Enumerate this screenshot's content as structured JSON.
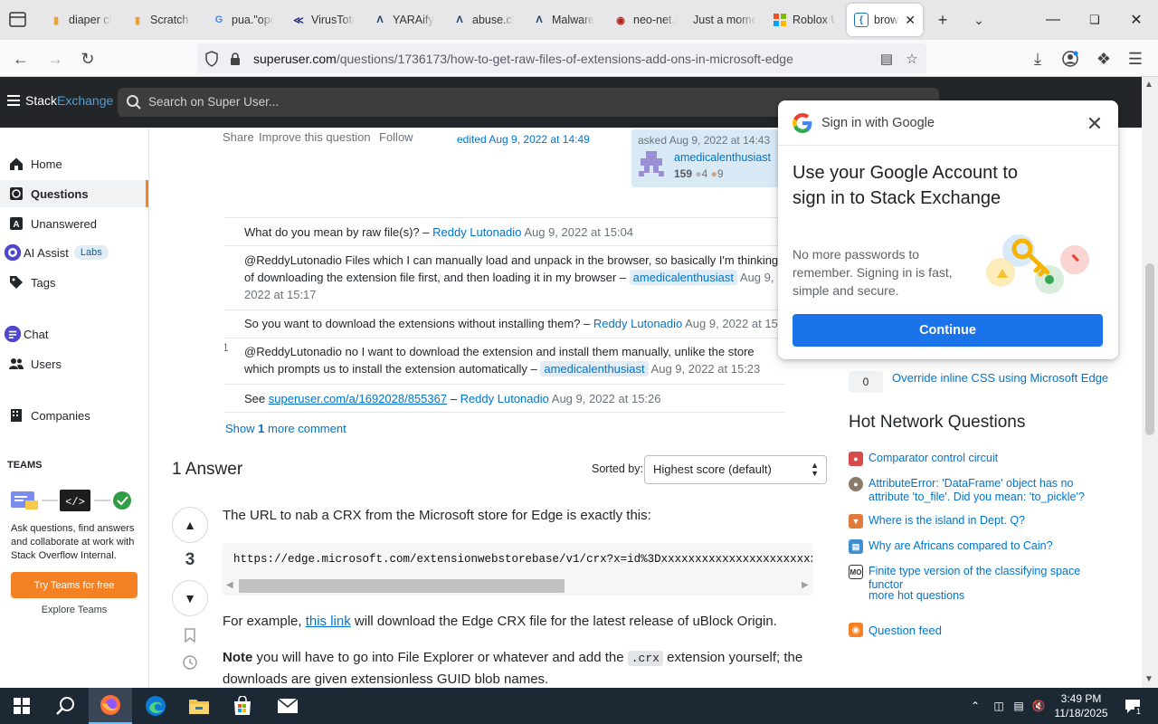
{
  "browser": {
    "tabs": [
      {
        "label": "diaper cl",
        "icon": "page-icon"
      },
      {
        "label": "Scratch -",
        "icon": "page-icon"
      },
      {
        "label": "pua.\"ope",
        "icon": "google-icon"
      },
      {
        "label": "VirusTota",
        "icon": "virustotal-icon"
      },
      {
        "label": "YARAify |",
        "icon": "yaraify-icon"
      },
      {
        "label": "abuse.ch",
        "icon": "abusech-icon"
      },
      {
        "label": "Malware",
        "icon": "abusech-icon"
      },
      {
        "label": "neo-net.i",
        "icon": "neonet-icon"
      },
      {
        "label": "Just a mome",
        "icon": "none"
      },
      {
        "label": "Roblox U",
        "icon": "roblox-icon"
      },
      {
        "label": "brows",
        "icon": "superuser-icon",
        "active": true
      }
    ],
    "url_host": "superuser.com",
    "url_path": "/questions/1736173/how-to-get-raw-files-of-extensions-add-ons-in-microsoft-edge"
  },
  "topbar": {
    "logo_stack": "Stack",
    "logo_exchange": "Exchange",
    "search_placeholder": "Search on Super User..."
  },
  "leftnav": {
    "items": [
      {
        "label": "Home",
        "icon": "home-icon"
      },
      {
        "label": "Questions",
        "icon": "globe-icon",
        "active": true
      },
      {
        "label": "Unanswered",
        "icon": "unanswered-icon"
      },
      {
        "label": "AI Assist",
        "icon": "ai-assist-icon",
        "badge": "Labs"
      },
      {
        "label": "Tags",
        "icon": "tag-icon"
      },
      {
        "label": "Chat",
        "icon": "chat-icon"
      },
      {
        "label": "Users",
        "icon": "users-icon"
      },
      {
        "label": "Companies",
        "icon": "companies-icon"
      }
    ],
    "teams_title": "TEAMS",
    "teams_desc": "Ask questions, find answers and collaborate at work with Stack Overflow Internal.",
    "teams_button": "Try Teams for free",
    "teams_explore": "Explore Teams"
  },
  "question": {
    "share": "Share",
    "improve": "Improve this question",
    "follow": "Follow",
    "edited": "edited Aug 9, 2022 at 14:49",
    "asked": "asked Aug 9, 2022 at 14:43",
    "asker": "amedicalenthusiast",
    "rep": "159",
    "silver": "4",
    "bronze": "9"
  },
  "comments": [
    {
      "score": "",
      "text": "What do you mean by raw file(s)? –",
      "user": "Reddy Lutonadio",
      "date": "Aug 9, 2022 at 15:04"
    },
    {
      "score": "",
      "text": "@ReddyLutonadio Files which I can manually load and unpack in the browser, so basically I'm thinking of downloading the extension file first, and then loading it in my browser –",
      "user": "amedicalenthusiast",
      "date": "Aug 9, 2022 at 15:17"
    },
    {
      "score": "",
      "text": "So you want to download the extensions without installing them? –",
      "user": "Reddy Lutonadio",
      "date": "Aug 9, 2022 at 15:"
    },
    {
      "score": "1",
      "text": "@ReddyLutonadio no I want to download the extension and install them manually, unlike the store which prompts us to install the extension automatically –",
      "user": "amedicalenthusiast",
      "date": "Aug 9, 2022 at 15:23"
    },
    {
      "score": "",
      "text_pre": "See",
      "link": "superuser.com/a/1692028/855367",
      "text": " –",
      "user": "Reddy Lutonadio",
      "date": "Aug 9, 2022 at 15:26"
    }
  ],
  "show_more": {
    "pre": "Show",
    "count": "1",
    "post": "more comment"
  },
  "answers": {
    "heading": "1 Answer",
    "sorted_by": "Sorted by:",
    "sort_value": "Highest score (default)",
    "score": "3",
    "p1": "The URL to nab a CRX from the Microsoft store for Edge is exactly this:",
    "code": "https://edge.microsoft.com/extensionwebstorebase/v1/crx?x=id%3Dxxxxxxxxxxxxxxxxxxxxxxxxxxxxxx",
    "p2_pre": "For example,",
    "p2_link": "this link",
    "p2_post": "will download the Edge CRX file for the latest release of uBlock Origin.",
    "p3_bold": "Note",
    "p3_a": "you will have to go into File Explorer or whatever and add the",
    "p3_code": ".crx",
    "p3_b": "extension yourself; the downloads are given extensionless GUID blob names."
  },
  "rightside": {
    "related_count": "0",
    "related_link": "Override inline CSS using Microsoft Edge",
    "hnq_title": "Hot Network Questions",
    "hnq": [
      {
        "label": "Comparator control circuit",
        "color": "#d94a4a",
        "icon": "electronics-icon"
      },
      {
        "label": "AttributeError: 'DataFrame' object has no attribute 'to_file'. Did you mean: 'to_pickle'?",
        "color": "#8c7b6b",
        "icon": "gis-icon"
      },
      {
        "label": "Where is the island in Dept. Q?",
        "color": "#e07b39",
        "icon": "movies-icon"
      },
      {
        "label": "Why are Africans compared to Cain?",
        "color": "#3d8fd1",
        "icon": "hermeneutics-icon"
      },
      {
        "label": "Finite type version of the classifying space functor",
        "color": "#333333",
        "icon": "mathoverflow-icon"
      }
    ],
    "more_hnq": "more hot questions",
    "feed": "Question feed"
  },
  "gsi": {
    "header": "Sign in with Google",
    "title": "Use your Google Account to sign in to Stack Exchange",
    "desc": "No more passwords to remember. Signing in is fast, simple and secure.",
    "button": "Continue"
  },
  "taskbar": {
    "time": "3:49 PM",
    "date": "11/18/2025",
    "notifications": "1"
  }
}
